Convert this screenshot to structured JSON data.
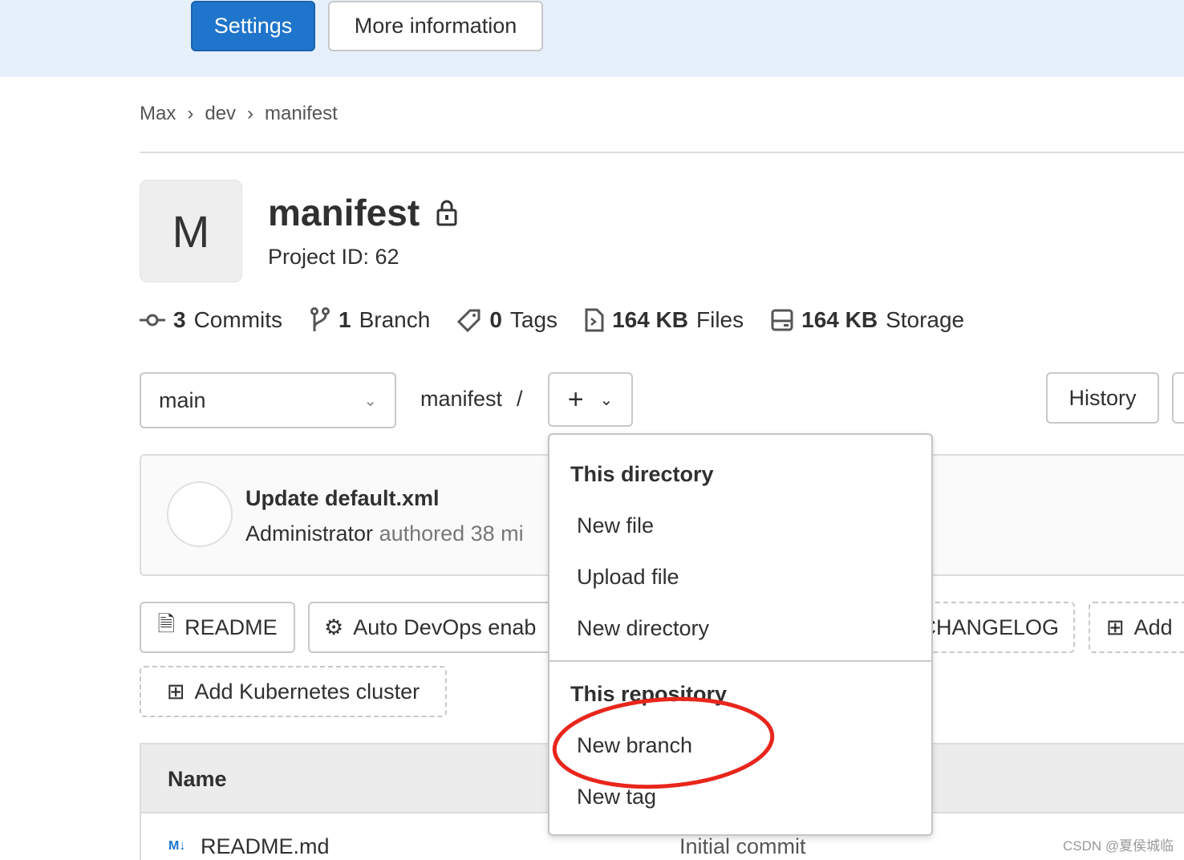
{
  "topbar": {
    "settings_label": "Settings",
    "more_info_label": "More information"
  },
  "breadcrumb": [
    "Max",
    "dev",
    "manifest"
  ],
  "project": {
    "avatar_letter": "M",
    "name": "manifest",
    "id_text": "Project ID: 62",
    "visibility_icon": "lock-icon"
  },
  "stats": [
    {
      "icon": "commit-icon",
      "value": "3",
      "label": "Commits"
    },
    {
      "icon": "branch-icon",
      "value": "1",
      "label": "Branch"
    },
    {
      "icon": "tag-icon",
      "value": "0",
      "label": "Tags"
    },
    {
      "icon": "file-icon",
      "value": "164 KB",
      "label": "Files"
    },
    {
      "icon": "storage-icon",
      "value": "164 KB",
      "label": "Storage"
    }
  ],
  "repo_bar": {
    "branch": "main",
    "path": "manifest",
    "separator": "/",
    "history_label": "History"
  },
  "last_commit": {
    "title": "Update default.xml",
    "author": "Administrator",
    "meta": "authored 38 mi"
  },
  "quick_actions": {
    "readme": "README",
    "auto_devops": "Auto DevOps enab",
    "changelog": "CHANGELOG",
    "add": "Add",
    "add_k8s": "Add Kubernetes cluster"
  },
  "dropdown": {
    "section1": "This directory",
    "new_file": "New file",
    "upload_file": "Upload file",
    "new_directory": "New directory",
    "section2": "This repository",
    "new_branch": "New branch",
    "new_tag": "New tag"
  },
  "table": {
    "name_header": "Name",
    "rows": [
      {
        "name": "README.md",
        "commit": "Initial commit"
      }
    ]
  },
  "annotation_color": "#e8261c",
  "watermark": "CSDN @夏侯城临"
}
